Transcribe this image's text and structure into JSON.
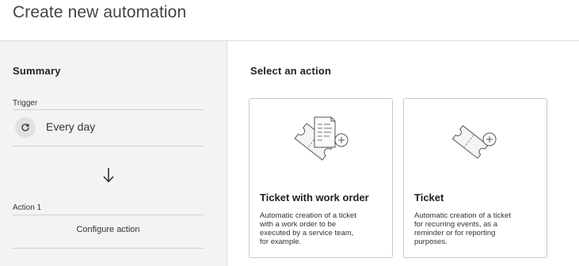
{
  "header": {
    "title": "Create new automation"
  },
  "summary": {
    "title": "Summary",
    "trigger_label": "Trigger",
    "trigger_value": "Every day",
    "action_label": "Action 1",
    "configure_action": "Configure action"
  },
  "main": {
    "title": "Select an action",
    "cards": [
      {
        "title": "Ticket with work order",
        "description_lines": [
          "Automatic creation of a ticket",
          "with a work order to be",
          "executed by a service team,",
          "for example."
        ]
      },
      {
        "title": "Ticket",
        "description_lines": [
          "Automatic creation of a ticket",
          "for recurring events, as a",
          "reminder or for reporting",
          "purposes."
        ]
      }
    ]
  },
  "icons": {
    "trigger": "recurring-refresh-icon",
    "arrow": "arrow-down-icon",
    "card1": "ticket-with-work-order-illustration",
    "card2": "ticket-illustration"
  }
}
